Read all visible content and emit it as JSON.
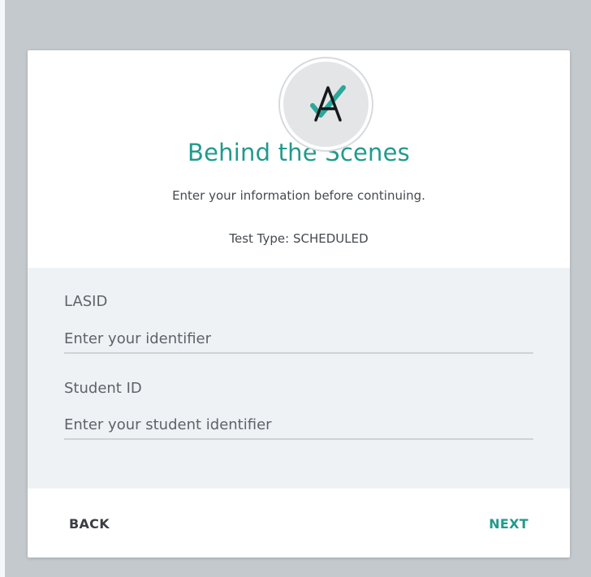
{
  "header": {
    "logo_icon": "checkmark-a-logo-icon",
    "title": "Behind the Scenes",
    "subtitle": "Enter your information before continuing.",
    "test_type": "Test Type: SCHEDULED"
  },
  "form": {
    "lasid": {
      "label": "LASID",
      "value": "",
      "placeholder": "Enter your identifier"
    },
    "student_id": {
      "label": "Student ID",
      "value": "",
      "placeholder": "Enter your student identifier"
    }
  },
  "footer": {
    "back_label": "BACK",
    "next_label": "NEXT"
  },
  "colors": {
    "accent": "#219a8c",
    "background": "#c4c9cd",
    "form_background": "#eff2f4"
  }
}
